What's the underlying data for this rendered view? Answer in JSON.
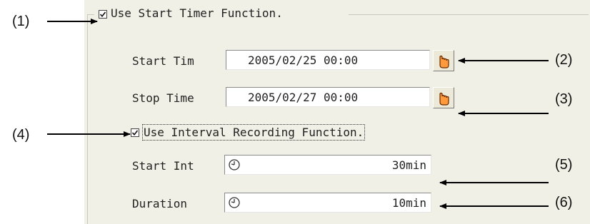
{
  "group": {
    "label": "Use Start Timer Function.",
    "checked": true,
    "start_time": {
      "label": "Start Tim",
      "value": "2005/02/25 00:00"
    },
    "stop_time": {
      "label": "Stop Time",
      "value": "2005/02/27 00:00"
    },
    "interval": {
      "label": "Use Interval Recording Function.",
      "checked": true,
      "start_interval": {
        "label": "Start Int",
        "value": "30min"
      },
      "duration": {
        "label": "Duration",
        "value": "10min"
      }
    }
  },
  "callouts": [
    "(1)",
    "(2)",
    "(3)",
    "(4)",
    "(5)",
    "(6)"
  ],
  "icons": {
    "picker": "hand-pointer-icon",
    "clock": "clock-icon",
    "check": "checkmark-icon"
  }
}
